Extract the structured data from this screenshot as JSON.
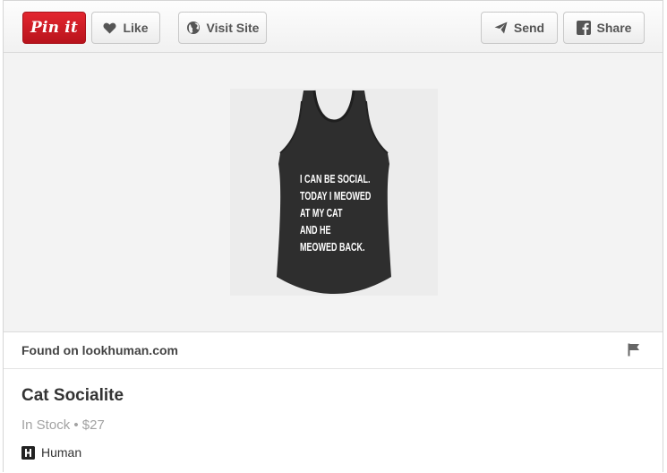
{
  "toolbar": {
    "pin_label": "Pin it",
    "like_label": "Like",
    "visit_label": "Visit Site",
    "send_label": "Send",
    "share_label": "Share"
  },
  "product_image": {
    "shirt_lines": [
      "I CAN BE SOCIAL.",
      "TODAY I MEOWED",
      "AT MY CAT",
      "AND HE",
      "MEOWED BACK."
    ]
  },
  "source": {
    "found_on": "Found on lookhuman.com"
  },
  "details": {
    "title": "Cat Socialite",
    "meta": "In Stock • $27",
    "brand": "Human"
  },
  "colors": {
    "pinterest_red": "#cb2027",
    "toolbar_bg": "#f3f3f3",
    "title_text": "#333333",
    "meta_text": "#a2a2a2"
  },
  "icons": {
    "like": "heart-icon",
    "visit": "globe-icon",
    "send": "paper-plane-icon",
    "share": "facebook-icon",
    "report": "flag-icon",
    "brand": "human-logo-icon"
  }
}
